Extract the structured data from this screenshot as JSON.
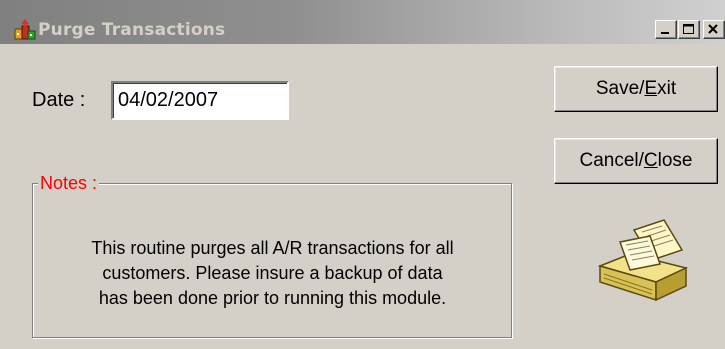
{
  "window": {
    "title": "Purge Transactions",
    "controls": {
      "minimize_icon": "minimize-icon",
      "maximize_icon": "maximize-icon",
      "close_icon": "close-icon"
    }
  },
  "form": {
    "date_label": "Date :",
    "date_value": "04/02/2007"
  },
  "buttons": {
    "save_exit": {
      "prefix": "Save/",
      "mnemonic": "E",
      "suffix": "xit"
    },
    "cancel_close": {
      "prefix": "Cancel/",
      "mnemonic": "C",
      "suffix": "lose"
    }
  },
  "notes": {
    "legend": "Notes :",
    "lines": [
      "This routine purges all A/R transactions for all",
      "customers.  Please insure a backup of data",
      "has been done prior to running this module."
    ]
  },
  "colors": {
    "face": "#d4d0c8",
    "legend_text": "#ff0000",
    "title_text": "#d4d0c8"
  },
  "icons": {
    "app": "app-icon",
    "decoration": "paper-stack-icon"
  }
}
